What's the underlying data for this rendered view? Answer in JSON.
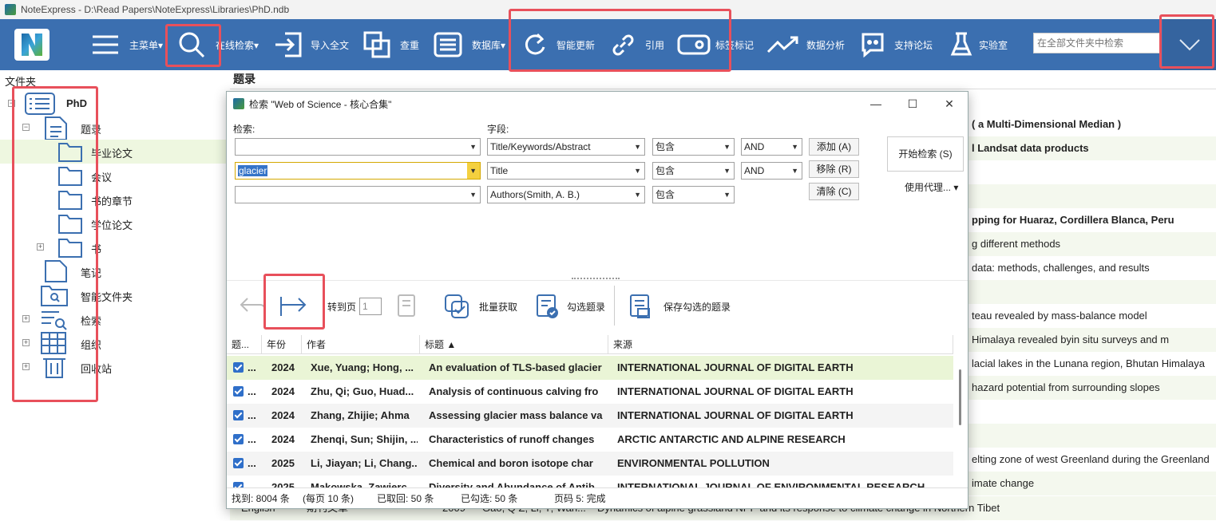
{
  "window": {
    "title": "NoteExpress - D:\\Read Papers\\NoteExpress\\Libraries\\PhD.ndb"
  },
  "toolbar": {
    "main_menu": "主菜单▾",
    "online_search": "在线检索▾",
    "import_fulltext": "导入全文",
    "dedupe": "查重",
    "database": "数据库▾",
    "smart_update": "智能更新",
    "cite": "引用",
    "tag": "标签标记",
    "analysis": "数据分析",
    "forum": "支持论坛",
    "lab": "实验室",
    "search_placeholder": "在全部文件夹中检索"
  },
  "folders": {
    "header": "文件夹",
    "root": "PhD",
    "items": [
      {
        "label": "题录"
      },
      {
        "label": "毕业论文"
      },
      {
        "label": "会议"
      },
      {
        "label": "书的章节"
      },
      {
        "label": "学位论文"
      },
      {
        "label": "书"
      },
      {
        "label": "笔记"
      },
      {
        "label": "智能文件夹"
      },
      {
        "label": "检索"
      },
      {
        "label": "组织"
      },
      {
        "label": "回收站"
      }
    ]
  },
  "main": {
    "header": "题录",
    "bg_rows": [
      "( a Multi-Dimensional Median )",
      "l Landsat data products",
      "pping for Huaraz, Cordillera Blanca, Peru",
      "g different methods",
      "data: methods, challenges, and results",
      "teau revealed by mass-balance model",
      "Himalaya revealed byin situ            surveys and m",
      "lacial lakes in the Lunana region, Bhutan Himalaya",
      "hazard potential from surrounding slopes",
      "elting zone of west Greenland during the Greenland",
      "imate change"
    ],
    "bottom_row": {
      "lang": "English",
      "type": "期刊文章",
      "year": "2009",
      "author": "Gao, Q Z; Li, Y; Wan...",
      "title": "Dynamics of alpine grassland NPP and its response to climate change in Northern Tibet"
    }
  },
  "dialog": {
    "title": "检索 \"Web of Science - 核心合集\"",
    "search_label": "检索:",
    "field_label": "字段:",
    "rows": [
      {
        "query": "",
        "field": "Title/Keywords/Abstract",
        "op": "包含",
        "logic": "AND"
      },
      {
        "query": "glacier",
        "field": "Title",
        "op": "包含",
        "logic": "AND"
      },
      {
        "query": "",
        "field": "Authors(Smith, A. B.)",
        "op": "包含",
        "logic": ""
      }
    ],
    "add_btn": "添加 (A)",
    "remove_btn": "移除 (R)",
    "clear_btn": "清除 (C)",
    "start_btn": "开始检索 (S)",
    "proxy_btn": "使用代理...",
    "goto_page": "转到页",
    "page_value": "1",
    "batch_get": "批量获取",
    "select_items": "勾选题录",
    "save_checked": "保存勾选的题录",
    "columns": [
      "题...",
      "年份",
      "作者",
      "标题 ▲",
      "来源"
    ],
    "results": [
      {
        "year": "2024",
        "author": "Xue, Yuang; Hong, ...",
        "title": "An evaluation of TLS-based glacier",
        "source": "INTERNATIONAL JOURNAL OF DIGITAL EARTH"
      },
      {
        "year": "2024",
        "author": "Zhu, Qi; Guo, Huad...",
        "title": "Analysis of continuous calving fro",
        "source": "INTERNATIONAL JOURNAL OF DIGITAL EARTH"
      },
      {
        "year": "2024",
        "author": "Zhang, Zhijie; Ahma",
        "title": "Assessing glacier mass balance va",
        "source": "INTERNATIONAL JOURNAL OF DIGITAL EARTH"
      },
      {
        "year": "2024",
        "author": "Zhenqi, Sun; Shijin, ...",
        "title": "Characteristics of runoff changes",
        "source": "ARCTIC ANTARCTIC AND ALPINE RESEARCH"
      },
      {
        "year": "2025",
        "author": "Li, Jiayan; Li, Chang...",
        "title": "Chemical and boron isotope char",
        "source": "ENVIRONMENTAL POLLUTION"
      },
      {
        "year": "2025",
        "author": "Makowska, Zawierc...",
        "title": "Diversity and Abundance of Antib",
        "source": "INTERNATIONAL JOURNAL OF ENVIRONMENTAL RESEARCH"
      }
    ],
    "row_marker": "...",
    "status": {
      "found": "找到: 8004 条",
      "per_page": "(每页 10 条)",
      "fetched": "已取回: 50 条",
      "checked": "已勾选: 50 条",
      "page": "页码 5: 完成"
    }
  }
}
